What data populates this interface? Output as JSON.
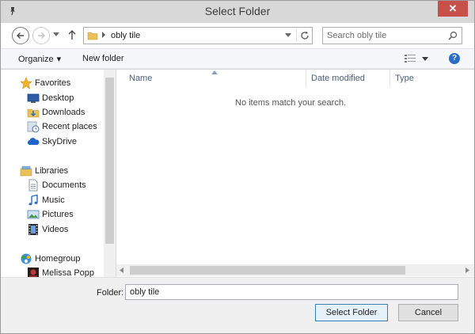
{
  "window": {
    "title": "Select Folder",
    "close_glyph": "✕"
  },
  "address": {
    "path_segment": "obly tile",
    "search_placeholder": "Search obly tile"
  },
  "toolbar": {
    "organize_label": "Organize",
    "organize_caret": "▾",
    "new_folder_label": "New folder",
    "help_glyph": "?"
  },
  "sidebar": {
    "favorites": {
      "label": "Favorites",
      "icon": "star-icon",
      "items": [
        {
          "label": "Desktop",
          "icon": "desktop-icon"
        },
        {
          "label": "Downloads",
          "icon": "downloads-icon"
        },
        {
          "label": "Recent places",
          "icon": "recent-places-icon"
        },
        {
          "label": "SkyDrive",
          "icon": "skydrive-icon"
        }
      ]
    },
    "libraries": {
      "label": "Libraries",
      "icon": "libraries-icon",
      "items": [
        {
          "label": "Documents",
          "icon": "documents-icon"
        },
        {
          "label": "Music",
          "icon": "music-icon"
        },
        {
          "label": "Pictures",
          "icon": "pictures-icon"
        },
        {
          "label": "Videos",
          "icon": "videos-icon"
        }
      ]
    },
    "homegroup": {
      "label": "Homegroup",
      "icon": "homegroup-icon",
      "items": [
        {
          "label": "Melissa Popp",
          "icon": "user-avatar-icon"
        }
      ]
    }
  },
  "content": {
    "columns": [
      "Name",
      "Date modified",
      "Type"
    ],
    "empty_message": "No items match your search."
  },
  "footer": {
    "folder_label": "Folder:",
    "folder_value": "obly tile",
    "select_button": "Select Folder",
    "cancel_button": "Cancel"
  },
  "colors": {
    "close_button": "#c7504a",
    "help_icon": "#2b6cc4",
    "primary_button_border": "#3c7fb1"
  }
}
